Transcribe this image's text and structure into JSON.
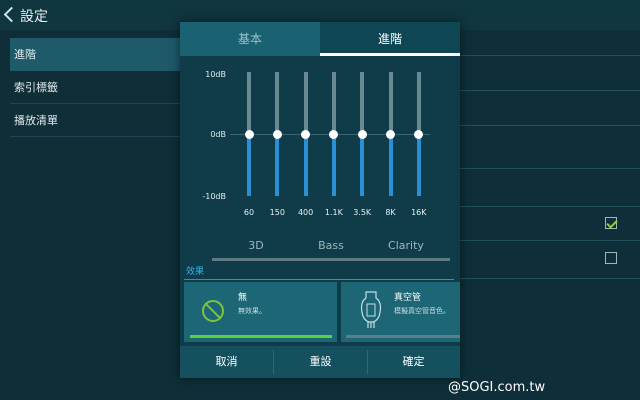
{
  "window": {
    "title": "設定"
  },
  "sidebar": {
    "items": [
      {
        "label": "進階",
        "active": true
      },
      {
        "label": "索引標籤",
        "active": false
      },
      {
        "label": "播放清單",
        "active": false
      }
    ]
  },
  "dialog": {
    "tabs": [
      {
        "label": "基本",
        "active": false
      },
      {
        "label": "進階",
        "active": true
      }
    ],
    "equalizer": {
      "db_labels": [
        "10dB",
        "0dB",
        "-10dB"
      ],
      "bands": [
        {
          "freq": "60",
          "gain_db": 0
        },
        {
          "freq": "150",
          "gain_db": 0
        },
        {
          "freq": "400",
          "gain_db": 0
        },
        {
          "freq": "1.1K",
          "gain_db": 0
        },
        {
          "freq": "3.5K",
          "gain_db": 0
        },
        {
          "freq": "8K",
          "gain_db": 0
        },
        {
          "freq": "16K",
          "gain_db": 0
        }
      ]
    },
    "effect_tabs": [
      "3D",
      "Bass",
      "Clarity"
    ],
    "effects_label": "效果",
    "effect_cards": [
      {
        "title": "無",
        "desc": "無效果。",
        "selected": true
      },
      {
        "title": "真空管",
        "desc": "模擬真空管音色。",
        "selected": false
      }
    ],
    "actions": {
      "cancel": "取消",
      "reset": "重設",
      "ok": "確定"
    }
  },
  "settings_checkboxes": [
    {
      "checked": true
    },
    {
      "checked": false
    }
  ],
  "watermark": "@SOGI.com.tw",
  "colors": {
    "accent": "#2a8fd6",
    "green": "#7dc33b",
    "dialog_bg": "#0f3c48"
  }
}
